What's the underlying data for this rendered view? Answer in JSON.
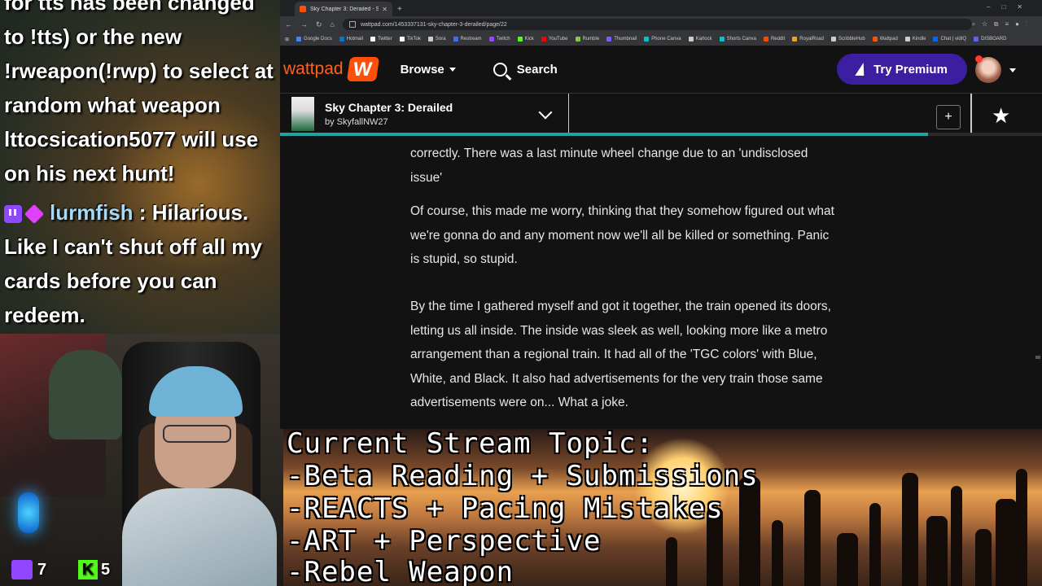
{
  "chat": {
    "lines": [
      "for tts has been changed",
      "to !tts) or the new",
      "!rweapon(!rwp) to select at",
      "random what weapon",
      "lttocsication5077 will use",
      "on his next hunt!"
    ],
    "message": {
      "user": "lurmfish",
      "sep": " : ",
      "first": "Hilarious.",
      "lines": [
        "Like I can't shut off all my",
        "cards before you can",
        "redeem."
      ]
    }
  },
  "cam": {
    "twitch_count": "7",
    "kick_letter": "K",
    "kick_count": "5"
  },
  "browser": {
    "tab_title": "Sky Chapter 3: Derailed - Sky C",
    "url": "wattpad.com/1453337131-sky-chapter-3-derailed/page/22",
    "bookmarks": [
      {
        "label": "Google Docs",
        "color": "#4285f4"
      },
      {
        "label": "Hotmail",
        "color": "#0078d4"
      },
      {
        "label": "Twitter",
        "color": "#ffffff"
      },
      {
        "label": "TikTok",
        "color": "#ffffff"
      },
      {
        "label": "Sora",
        "color": "#cccccc"
      },
      {
        "label": "Restream",
        "color": "#3c6df0"
      },
      {
        "label": "Twitch",
        "color": "#9146ff"
      },
      {
        "label": "Kick",
        "color": "#53fc18"
      },
      {
        "label": "YouTube",
        "color": "#ff0000"
      },
      {
        "label": "Rumble",
        "color": "#85c742"
      },
      {
        "label": "Thumbnail",
        "color": "#7a5cff"
      },
      {
        "label": "Phone Canva",
        "color": "#00c4cc"
      },
      {
        "label": "Karlock",
        "color": "#cccccc"
      },
      {
        "label": "Shorts Canva",
        "color": "#00c4cc"
      },
      {
        "label": "Reddit",
        "color": "#ff4500"
      },
      {
        "label": "RoyalRoad",
        "color": "#f0a020"
      },
      {
        "label": "ScribbleHub",
        "color": "#cccccc"
      },
      {
        "label": "Wattpad",
        "color": "#ff500a"
      },
      {
        "label": "Kindle",
        "color": "#cccccc"
      },
      {
        "label": "Chat | vidIQ",
        "color": "#0066ff"
      },
      {
        "label": "DISBOARD",
        "color": "#5865f2"
      }
    ]
  },
  "wattpad": {
    "logo": "wattpad",
    "browse": "Browse",
    "search": "Search",
    "premium": "Try Premium",
    "story_title": "Sky Chapter 3: Derailed",
    "story_author": "by SkyfallNW27",
    "plus": "+",
    "progress": 0.85,
    "paragraphs": [
      [
        "correctly. There was a last minute wheel change due to an 'undisclosed",
        "issue'"
      ],
      [
        "Of course, this made me worry, thinking that they somehow figured out what",
        "we're gonna do and any moment now we'll all be killed or something. Panic",
        "is stupid, so stupid."
      ],
      [
        "By the time I gathered myself and got it together, the train opened its doors,",
        "letting us all inside. The inside was sleek as well, looking more like a metro",
        "arrangement than a regional train. It had all of the 'TGC colors' with Blue,",
        "White, and Black. It also had advertisements for the very train those same",
        "advertisements were on... What a joke."
      ]
    ]
  },
  "banner": {
    "lines": [
      "Current Stream Topic:",
      "-Beta Reading + Submissions",
      "-REACTS + Pacing Mistakes",
      "-ART + Perspective",
      "-Rebel Weapon"
    ]
  }
}
